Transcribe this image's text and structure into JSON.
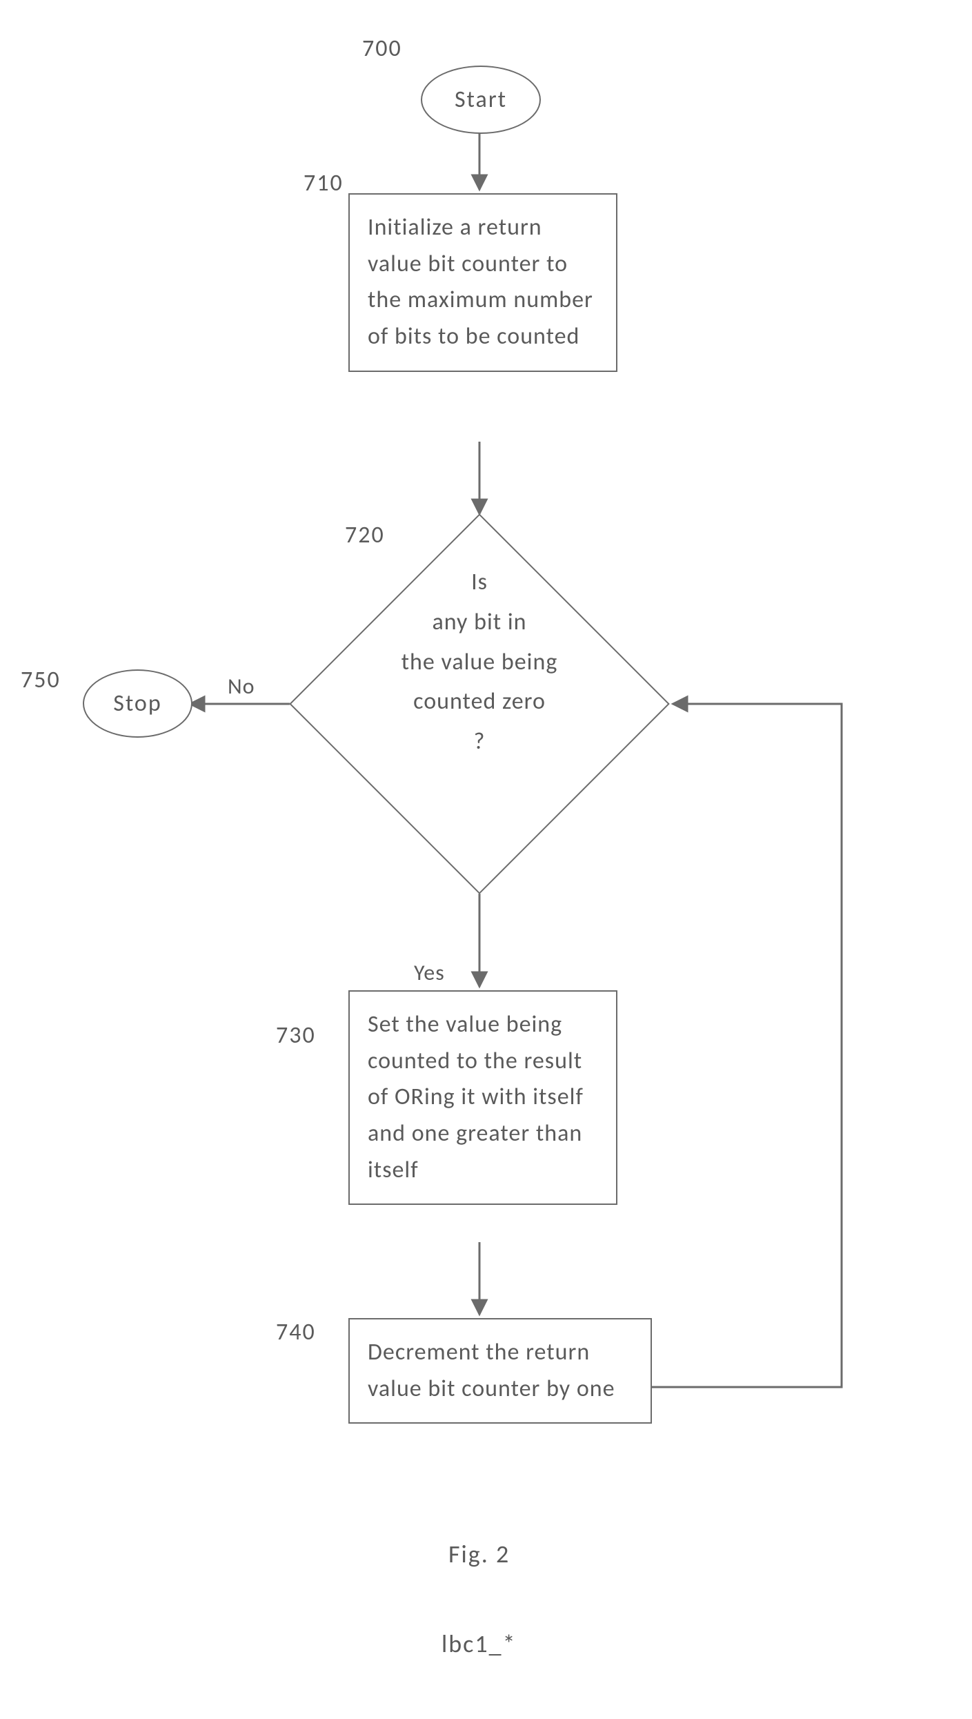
{
  "chart_data": {
    "type": "flowchart",
    "title": "Fig. 2",
    "subtitle": "lbc1_*",
    "nodes": [
      {
        "id": "700",
        "ref": "700",
        "kind": "terminator",
        "text": "Start"
      },
      {
        "id": "710",
        "ref": "710",
        "kind": "process",
        "text": "Initialize a return value bit counter to the maximum number of bits to be counted"
      },
      {
        "id": "720",
        "ref": "720",
        "kind": "decision",
        "text": "Is any bit in the value being counted zero ?"
      },
      {
        "id": "730",
        "ref": "730",
        "kind": "process",
        "text": "Set the value being counted to the result of ORing it with itself and one greater than itself"
      },
      {
        "id": "740",
        "ref": "740",
        "kind": "process",
        "text": "Decrement the return value bit counter by one"
      },
      {
        "id": "750",
        "ref": "750",
        "kind": "terminator",
        "text": "Stop"
      }
    ],
    "edges": [
      {
        "from": "700",
        "to": "710",
        "label": ""
      },
      {
        "from": "710",
        "to": "720",
        "label": ""
      },
      {
        "from": "720",
        "to": "730",
        "label": "Yes"
      },
      {
        "from": "720",
        "to": "750",
        "label": "No"
      },
      {
        "from": "730",
        "to": "740",
        "label": ""
      },
      {
        "from": "740",
        "to": "720",
        "label": ""
      }
    ]
  },
  "labels": {
    "start": "Start",
    "stop": "Stop",
    "r700": "700",
    "r710": "710",
    "r720": "720",
    "r730": "730",
    "r740": "740",
    "r750": "750",
    "yes": "Yes",
    "no": "No",
    "fig": "Fig. 2",
    "sub": "lbc1_*",
    "p710": "Initialize a return value bit counter to the maximum number of bits to be counted",
    "d720": "Is\nany bit in\nthe value being\ncounted zero\n?",
    "p730": "Set the value being counted to the result of ORing it with itself and one greater than itself",
    "p740": "Decrement the return value bit counter by one"
  }
}
